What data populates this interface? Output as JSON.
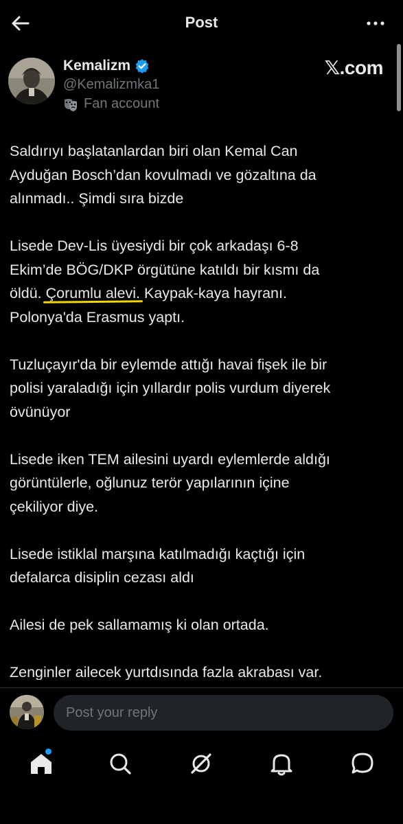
{
  "header": {
    "title": "Post",
    "back_icon": "back-arrow-icon",
    "more_icon": "more-horizontal-icon"
  },
  "author": {
    "display_name": "Kemalizm",
    "handle": "@Kemalizmka1",
    "badge_icon": "verified-badge-icon",
    "label_icon": "theater-mask-icon",
    "label": "Fan account",
    "badge_color": "#1d9bf0"
  },
  "brand": {
    "text": "𝕏.com"
  },
  "post": {
    "paragraphs": [
      "Saldırıyı başlatanlardan biri olan Kemal Can\nAyduğan Bosch’dan kovulmadı ve gözaltına da\nalınmadı.. Şimdi sıra bizde",
      "Tuzluçayır'da bir eylemde attığı havai fişek ile bir\npolisi yaraladığı için yıllardır polis vurdum diyerek\növünüyor",
      "Lisede iken TEM ailesini uyardı eylemlerde aldığı\ngörüntülerle, oğlunuz terör yapılarının içine\nçekiliyor diye.",
      "Lisede istiklal marşına katılmadığı kaçtığı için\ndefalarca disiplin cezası aldı",
      "Ailesi de pek sallamamış ki olan ortada.",
      "Zenginler ailecek yurtdısında fazla akrabası var."
    ],
    "p2": {
      "before": "Lisede Dev-Lis üyesiydi bir çok arkadaşı 6-8\nEkim’de BÖG/DKP örgütüne katıldı bir kısmı da\nöldü. ",
      "highlight": "Çorumlu alevi.",
      "after": " Kaypak-kaya hayranı.\nPolonya'da Erasmus yaptı."
    },
    "highlight_color": "#f2d600"
  },
  "reply": {
    "placeholder": "Post your reply"
  },
  "tabs": [
    {
      "icon": "home-icon",
      "active": true,
      "notification_dot": true
    },
    {
      "icon": "search-icon",
      "active": false
    },
    {
      "icon": "grok-icon",
      "active": false
    },
    {
      "icon": "bell-icon",
      "active": false
    },
    {
      "icon": "messages-icon",
      "active": false
    }
  ],
  "colors": {
    "background": "#000000",
    "text": "#e7e9ea",
    "secondary_text": "#71767b",
    "accent": "#1d9bf0"
  }
}
